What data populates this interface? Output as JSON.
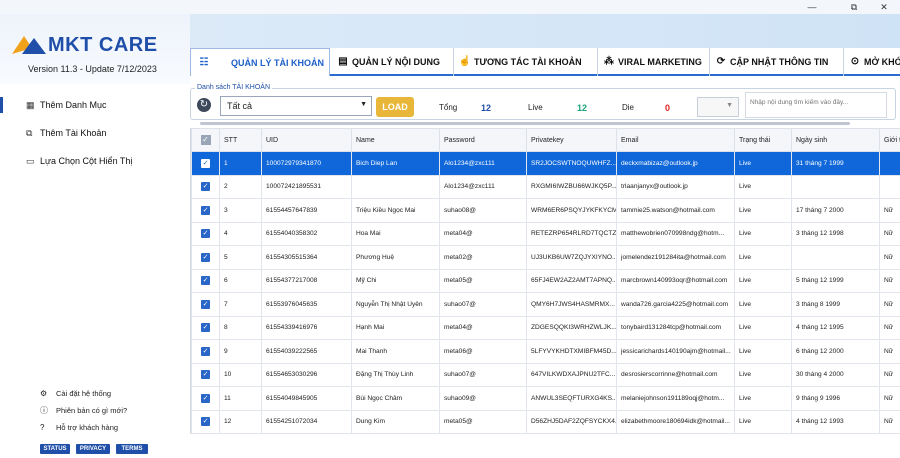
{
  "window": {
    "minimize": "—",
    "maximize": "⧉",
    "close": "✕"
  },
  "brand": {
    "name": "MKT CARE",
    "version": "Version  11.3 - Update  7/12/2023"
  },
  "tabs": [
    {
      "label": "QUẢN LÝ TÀI KHOẢN",
      "icon": "list-icon"
    },
    {
      "label": "QUẢN LÝ NỘI DUNG",
      "icon": "document-icon"
    },
    {
      "label": "TƯƠNG TÁC TÀI KHOẢN",
      "icon": "hand-icon"
    },
    {
      "label": "VIRAL MARKETING",
      "icon": "share-icon"
    },
    {
      "label": "CẬP NHẬT THÔNG TIN",
      "icon": "sync-icon"
    },
    {
      "label": "MỞ KHÓ",
      "icon": "unlock-icon"
    }
  ],
  "sidebar": {
    "items": [
      {
        "label": "Thêm Danh Mục",
        "icon": "category-icon"
      },
      {
        "label": "Thêm Tài Khoản",
        "icon": "add-account-icon"
      },
      {
        "label": "Lựa Chọn Cột Hiển Thị",
        "icon": "monitor-icon"
      }
    ],
    "help": [
      {
        "label": "Cài đặt hệ thống",
        "icon": "gear-icon"
      },
      {
        "label": "Phiên bản có gì mới?",
        "icon": "info-icon"
      },
      {
        "label": "Hỗ trợ khách hàng",
        "icon": "help-icon"
      }
    ],
    "pills": [
      "STATUS",
      "PRIVACY",
      "TERMS"
    ]
  },
  "filter": {
    "legend": "Danh sách TÀI KHOẢN",
    "select_value": "Tất cả",
    "load_label": "LOAD",
    "total_label": "Tổng",
    "total": "12",
    "live_label": "Live",
    "live": "12",
    "die_label": "Die",
    "die": "0",
    "search_placeholder": "Nhập nội dung tìm kiếm vào đây...",
    "colors": {
      "total": "#1f4fa8",
      "live": "#1aa37a",
      "die": "#e02020"
    }
  },
  "table": {
    "columns": [
      "",
      "STT",
      "UID",
      "Name",
      "Password",
      "Privatekey",
      "Email",
      "Trạng thái",
      "Ngày sinh",
      "Giới t"
    ],
    "rows": [
      [
        "1",
        "100072979341870",
        "Bich Diep Lan",
        "Alo1234@zxc111",
        "SR2JOCSWTNOQUWHFZ...",
        "deckxmabizaz@outlook.jp",
        "Live",
        "31 tháng 7 1999",
        ""
      ],
      [
        "2",
        "100072421895531",
        "",
        "Alo1234@zxc111",
        "RXGMI6IWZBU66WJKQ5P...",
        "trlaanjanyx@outlook.jp",
        "Live",
        "",
        ""
      ],
      [
        "3",
        "61554457647839",
        "Triệu Kiều Ngọc Mai",
        "suhao08@",
        "WRM6ER6PSQYJYKFKYCM...",
        "tammie25.watson@hotmail.com",
        "Live",
        "17 tháng 7 2000",
        "Nữ"
      ],
      [
        "4",
        "61554040358302",
        "Hoa Mai",
        "meta04@",
        "RETEZRP654RLRD7TQCTZ...",
        "matthewobrien070998ndg@hotm...",
        "Live",
        "3 tháng 12 1998",
        "Nữ"
      ],
      [
        "5",
        "61554305515364",
        "Phương Huệ",
        "meta02@",
        "UJ3UKB6UW7ZQJYXIYNO...",
        "jomelendez191284ita@hotmail.com",
        "Live",
        "",
        "Nữ"
      ],
      [
        "6",
        "61554377217008",
        "Mỹ Chi",
        "meta05@",
        "65FJ4EW2AZ2AMT7APNQ...",
        "marcbrown140993oqr@hotmail.com",
        "Live",
        "5 tháng 12 1999",
        "Nữ"
      ],
      [
        "7",
        "61553976045635",
        "Nguyễn Thị Nhật Uyên",
        "suhao07@",
        "QMY6H7JWS4HASMRMX...",
        "wanda726.garcia4225@hotmail.com",
        "Live",
        "3 tháng 8 1999",
        "Nữ"
      ],
      [
        "8",
        "61554339416976",
        "Hạnh Mai",
        "meta04@",
        "ZDGESQQKI3WRHZWLJK...",
        "tonybaird131284tcp@hotmail.com",
        "Live",
        "4 tháng 12 1995",
        "Nữ"
      ],
      [
        "9",
        "61554039222565",
        "Mai Thanh",
        "meta06@",
        "5LFYVYKHDTXMIBFM45D...",
        "jessicarichards140190ajm@hotmail...",
        "Live",
        "6 tháng 12 2000",
        "Nữ"
      ],
      [
        "10",
        "61554653030296",
        "Đặng Thị Thùy Linh",
        "suhao07@",
        "647VILKWDXAJPNU2TFC...",
        "desrosierscorrinne@hotmail.com",
        "Live",
        "30 tháng 4 2000",
        "Nữ"
      ],
      [
        "11",
        "61554049845905",
        "Bùi Ngọc Châm",
        "suhao09@",
        "ANWUL3SEQFTURXG4KS...",
        "melaniejohnson191189oqj@hotm...",
        "Live",
        "9 tháng 9 1996",
        "Nữ"
      ],
      [
        "12",
        "61554251072034",
        "Dung Kim",
        "meta05@",
        "D56ZHJ5DAF2ZQFSYCKX4...",
        "elizabethmoore180694idk@hotmail...",
        "Live",
        "4 tháng 12 1993",
        "Nữ"
      ]
    ]
  }
}
